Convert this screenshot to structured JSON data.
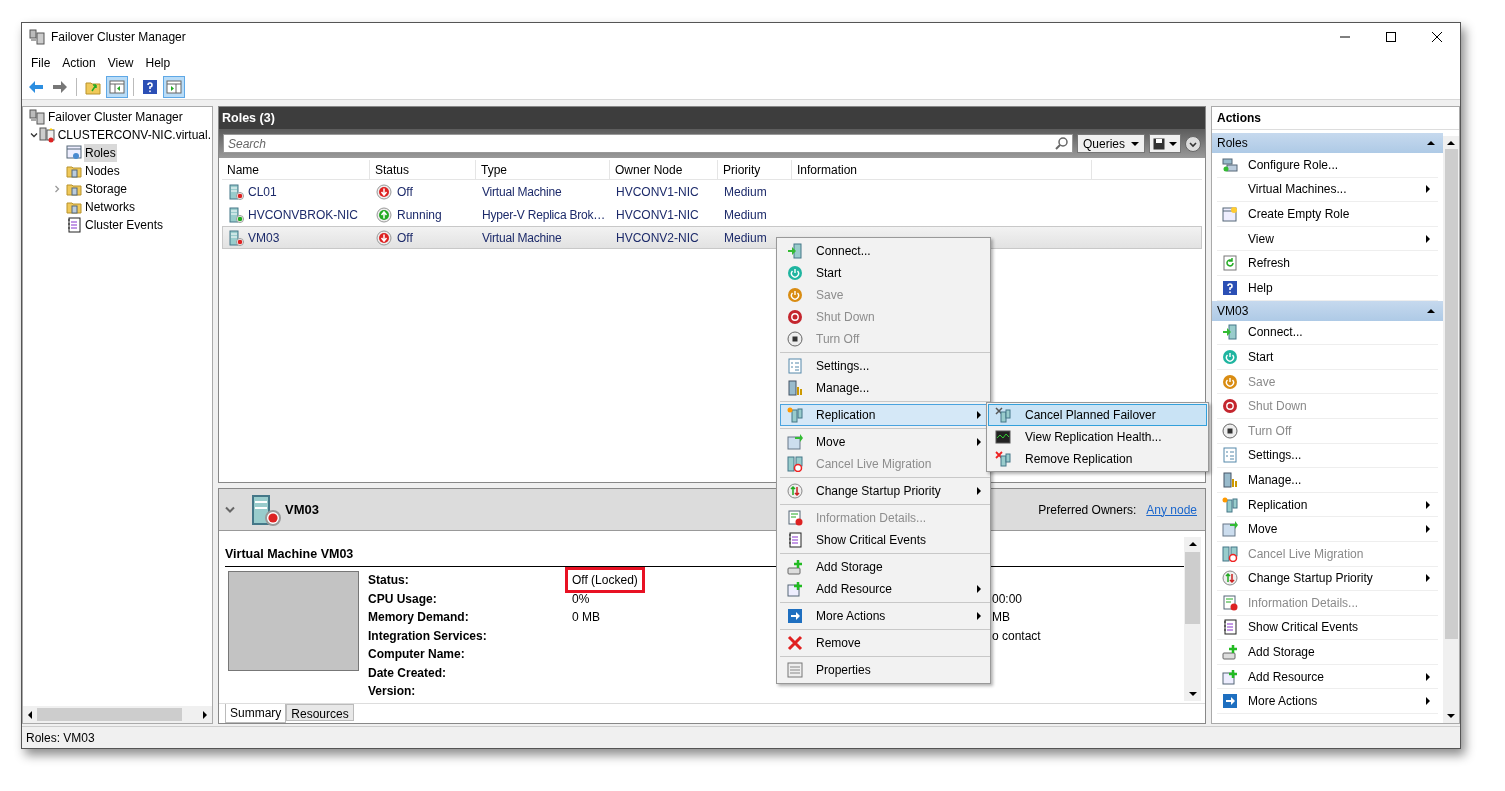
{
  "window": {
    "title": "Failover Cluster Manager"
  },
  "menu": [
    "File",
    "Action",
    "View",
    "Help"
  ],
  "toolbar": [
    {
      "kind": "back",
      "pressed": false
    },
    {
      "kind": "forward",
      "pressed": false
    },
    {
      "kind": "separator"
    },
    {
      "kind": "folder-up",
      "pressed": false
    },
    {
      "kind": "tree-panel",
      "pressed": true
    },
    {
      "kind": "separator"
    },
    {
      "kind": "help",
      "pressed": false
    },
    {
      "kind": "action-panel",
      "pressed": true
    }
  ],
  "tree": [
    {
      "label": "Failover Cluster Manager",
      "kind": "manager",
      "selected": false,
      "children": [
        {
          "label": "CLUSTERCONV-NIC.virtual.",
          "kind": "cluster",
          "selected": false,
          "expanded": true,
          "children": [
            {
              "label": "Roles",
              "kind": "roles",
              "selected": true
            },
            {
              "label": "Nodes",
              "kind": "folder",
              "selected": false
            },
            {
              "label": "Storage",
              "kind": "folder",
              "selected": false,
              "expanded": false
            },
            {
              "label": "Networks",
              "kind": "folder",
              "selected": false
            },
            {
              "label": "Cluster Events",
              "kind": "events",
              "selected": false
            }
          ]
        }
      ]
    }
  ],
  "roles": {
    "title": "Roles (3)",
    "search": {
      "placeholder": "Search"
    },
    "queries": "Queries",
    "columns": [
      "Name",
      "Status",
      "Type",
      "Owner Node",
      "Priority",
      "Information"
    ],
    "rows": [
      {
        "name": "CL01",
        "status": "Off",
        "kind": "off",
        "type": "Virtual Machine",
        "owner": "HVCONV1-NIC",
        "priority": "Medium",
        "selected": false
      },
      {
        "name": "HVCONVBROK-NIC",
        "status": "Running",
        "kind": "running",
        "type": "Hyper-V Replica Brok…",
        "owner": "HVCONV1-NIC",
        "priority": "Medium",
        "selected": false
      },
      {
        "name": "VM03",
        "status": "Off",
        "kind": "off",
        "type": "Virtual Machine",
        "owner": "HVCONV2-NIC",
        "priority": "Medium",
        "selected": true
      }
    ]
  },
  "details": {
    "name": "VM03",
    "preferred_label": "Preferred Owners:",
    "preferred_link": "Any node",
    "title": "Virtual Machine VM03",
    "fields": [
      {
        "label": "Status:",
        "value": "Off (Locked)",
        "highlighted": true
      },
      {
        "label": "CPU Usage:",
        "value": "0%",
        "extra": "00:00",
        "highlighted": false
      },
      {
        "label": "Memory Demand:",
        "value": "0 MB",
        "extra": "MB",
        "highlighted": false
      },
      {
        "label": "Integration Services:",
        "extra": "o contact",
        "highlighted": false
      },
      {
        "label": "Computer Name:",
        "highlighted": false
      },
      {
        "label": "Date Created:",
        "highlighted": false
      },
      {
        "label": "Version:",
        "highlighted": false
      }
    ],
    "tabs": [
      {
        "label": "Summary",
        "selected": true
      },
      {
        "label": "Resources",
        "selected": false
      }
    ]
  },
  "context_menu": {
    "groups": [
      {
        "items": [
          {
            "label": "Connect...",
            "kind": "connect",
            "disabled": false,
            "submenu": false,
            "selected": false
          },
          {
            "label": "Start",
            "kind": "start",
            "disabled": false,
            "submenu": false,
            "selected": false
          },
          {
            "label": "Save",
            "kind": "save",
            "disabled": true,
            "submenu": false,
            "selected": false
          },
          {
            "label": "Shut Down",
            "kind": "shutdown",
            "disabled": true,
            "submenu": false,
            "selected": false
          },
          {
            "label": "Turn Off",
            "kind": "turnoff",
            "disabled": true,
            "submenu": false,
            "selected": false
          }
        ]
      },
      {
        "items": [
          {
            "label": "Settings...",
            "kind": "settings",
            "disabled": false,
            "submenu": false,
            "selected": false
          },
          {
            "label": "Manage...",
            "kind": "manage",
            "disabled": false,
            "submenu": false,
            "selected": false
          }
        ]
      },
      {
        "items": [
          {
            "label": "Replication",
            "kind": "replication",
            "disabled": false,
            "submenu": true,
            "selected": true
          }
        ]
      },
      {
        "items": [
          {
            "label": "Move",
            "kind": "move",
            "disabled": false,
            "submenu": true,
            "selected": false
          },
          {
            "label": "Cancel Live Migration",
            "kind": "cancel-migration",
            "disabled": true,
            "submenu": false,
            "selected": false
          }
        ]
      },
      {
        "items": [
          {
            "label": "Change Startup Priority",
            "kind": "priority",
            "disabled": false,
            "submenu": true,
            "selected": false
          }
        ]
      },
      {
        "items": [
          {
            "label": "Information Details...",
            "kind": "info",
            "disabled": true,
            "submenu": false,
            "selected": false
          },
          {
            "label": "Show Critical Events",
            "kind": "events",
            "disabled": false,
            "submenu": false,
            "selected": false
          }
        ]
      },
      {
        "items": [
          {
            "label": "Add Storage",
            "kind": "add-storage",
            "disabled": false,
            "submenu": false,
            "selected": false
          },
          {
            "label": "Add Resource",
            "kind": "add-resource",
            "disabled": false,
            "submenu": true,
            "selected": false
          }
        ]
      },
      {
        "items": [
          {
            "label": "More Actions",
            "kind": "more",
            "disabled": false,
            "submenu": true,
            "selected": false
          }
        ]
      },
      {
        "items": [
          {
            "label": "Remove",
            "kind": "remove",
            "disabled": false,
            "submenu": false,
            "selected": false
          }
        ]
      },
      {
        "items": [
          {
            "label": "Properties",
            "kind": "properties",
            "disabled": false,
            "submenu": false,
            "selected": false
          }
        ]
      }
    ]
  },
  "submenu": [
    {
      "label": "Cancel Planned Failover",
      "kind": "cancel-failover",
      "selected": true
    },
    {
      "label": "View Replication Health...",
      "kind": "health",
      "selected": false
    },
    {
      "label": "Remove Replication",
      "kind": "remove-replication",
      "selected": false
    }
  ],
  "actions": {
    "title": "Actions",
    "sections": [
      {
        "heading": "Roles",
        "expanded": true,
        "items": [
          {
            "label": "Configure Role...",
            "kind": "configure",
            "disabled": false,
            "submenu": false
          },
          {
            "label": "Virtual Machines...",
            "kind": "none",
            "disabled": false,
            "submenu": true
          },
          {
            "label": "Create Empty Role",
            "kind": "create",
            "disabled": false,
            "submenu": false
          },
          {
            "label": "View",
            "kind": "none",
            "disabled": false,
            "submenu": true
          },
          {
            "label": "Refresh",
            "kind": "refresh",
            "disabled": false,
            "submenu": false
          },
          {
            "label": "Help",
            "kind": "help",
            "disabled": false,
            "submenu": false
          }
        ]
      },
      {
        "heading": "VM03",
        "expanded": true,
        "items": [
          {
            "label": "Connect...",
            "kind": "connect",
            "disabled": false,
            "submenu": false
          },
          {
            "label": "Start",
            "kind": "start",
            "disabled": false,
            "submenu": false
          },
          {
            "label": "Save",
            "kind": "save",
            "disabled": true,
            "submenu": false
          },
          {
            "label": "Shut Down",
            "kind": "shutdown",
            "disabled": true,
            "submenu": false
          },
          {
            "label": "Turn Off",
            "kind": "turnoff",
            "disabled": true,
            "submenu": false
          },
          {
            "label": "Settings...",
            "kind": "settings",
            "disabled": false,
            "submenu": false
          },
          {
            "label": "Manage...",
            "kind": "manage",
            "disabled": false,
            "submenu": false
          },
          {
            "label": "Replication",
            "kind": "replication",
            "disabled": false,
            "submenu": true
          },
          {
            "label": "Move",
            "kind": "move",
            "disabled": false,
            "submenu": true
          },
          {
            "label": "Cancel Live Migration",
            "kind": "cancel-migration",
            "disabled": true,
            "submenu": false
          },
          {
            "label": "Change Startup Priority",
            "kind": "priority",
            "disabled": false,
            "submenu": true
          },
          {
            "label": "Information Details...",
            "kind": "info",
            "disabled": true,
            "submenu": false
          },
          {
            "label": "Show Critical Events",
            "kind": "events",
            "disabled": false,
            "submenu": false
          },
          {
            "label": "Add Storage",
            "kind": "add-storage",
            "disabled": false,
            "submenu": false
          },
          {
            "label": "Add Resource",
            "kind": "add-resource",
            "disabled": false,
            "submenu": true
          },
          {
            "label": "More Actions",
            "kind": "more",
            "disabled": false,
            "submenu": true
          }
        ]
      }
    ]
  },
  "status_bar": "Roles: VM03"
}
